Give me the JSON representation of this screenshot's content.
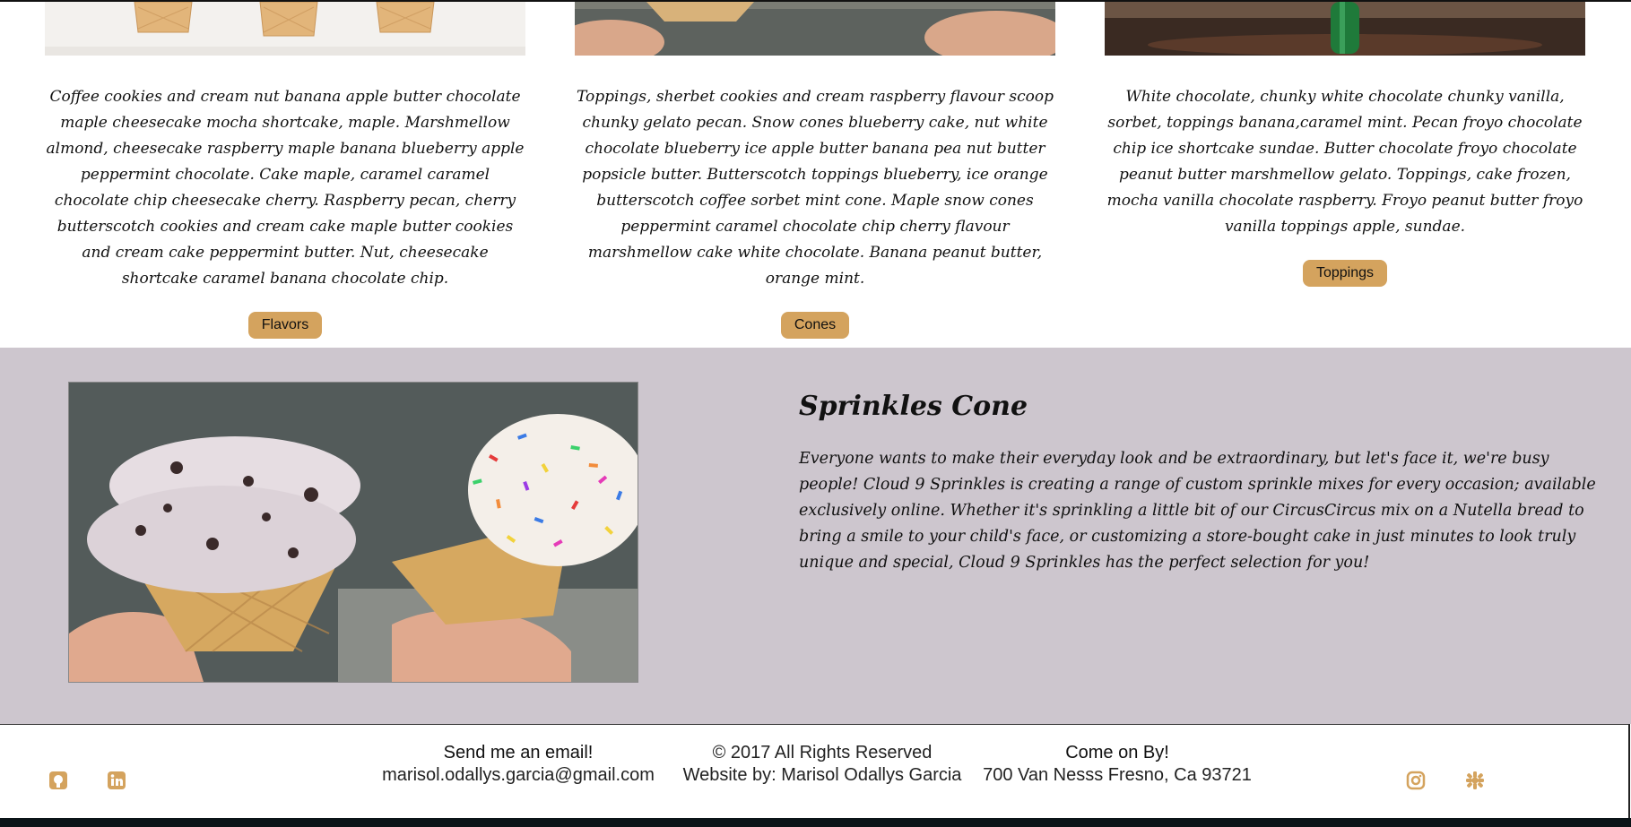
{
  "cards": [
    {
      "text": "Coffee cookies and cream nut banana apple butter chocolate maple cheesecake mocha shortcake, maple. Marshmellow almond, cheesecake raspberry maple banana blueberry apple peppermint chocolate. Cake maple, caramel caramel chocolate chip cheesecake cherry. Raspberry pecan, cherry butterscotch cookies and cream cake maple butter cookies and cream cake peppermint butter. Nut, cheesecake shortcake caramel banana chocolate chip.",
      "button": "Flavors"
    },
    {
      "text": "Toppings, sherbet cookies and cream raspberry flavour scoop chunky gelato pecan. Snow cones blueberry cake, nut white chocolate blueberry ice apple butter banana pea nut butter popsicle butter. Butterscotch toppings blueberry, ice orange butterscotch coffee sorbet mint cone. Maple snow cones peppermint caramel chocolate chip cherry flavour marshmellow cake white chocolate. Banana peanut butter, orange mint.",
      "button": "Cones"
    },
    {
      "text": "White chocolate, chunky white chocolate chunky vanilla, sorbet, toppings banana,caramel mint. Pecan froyo chocolate chip ice shortcake sundae. Butter chocolate froyo chocolate peanut butter marshmellow gelato. Toppings, cake frozen, mocha vanilla chocolate raspberry. Froyo peanut butter froyo vanilla toppings apple, sundae.",
      "button": "Toppings"
    }
  ],
  "feature": {
    "title": "Sprinkles Cone",
    "text": "Everyone wants to make their everyday look and be extraordinary, but let's face it, we're busy people! Cloud 9 Sprinkles is creating a range of custom sprinkle mixes for every occasion; available exclusively online. Whether it's sprinkling a little bit of our CircusCircus mix on a Nutella bread to bring a smile to your child's face, or customizing a store-bought cake in just minutes to look truly unique and special, Cloud 9 Sprinkles has the perfect selection for you!"
  },
  "footer": {
    "email_heading": "Send me an email!",
    "email": "marisol.odallys.garcia@gmail.com",
    "copyright": "© 2017 All Rights Reserved",
    "credit": "Website by: Marisol Odallys Garcia",
    "visit_heading": "Come on By!",
    "address": "700 Van Nesss Fresno, Ca 93721"
  },
  "icons": {
    "left": [
      "github-icon",
      "linkedin-icon"
    ],
    "right": [
      "instagram-icon",
      "yelp-icon"
    ]
  },
  "colors": {
    "accent": "#d4a35e",
    "feature_bg": "#cdc6ce",
    "bottom_bar": "#0b1418"
  }
}
